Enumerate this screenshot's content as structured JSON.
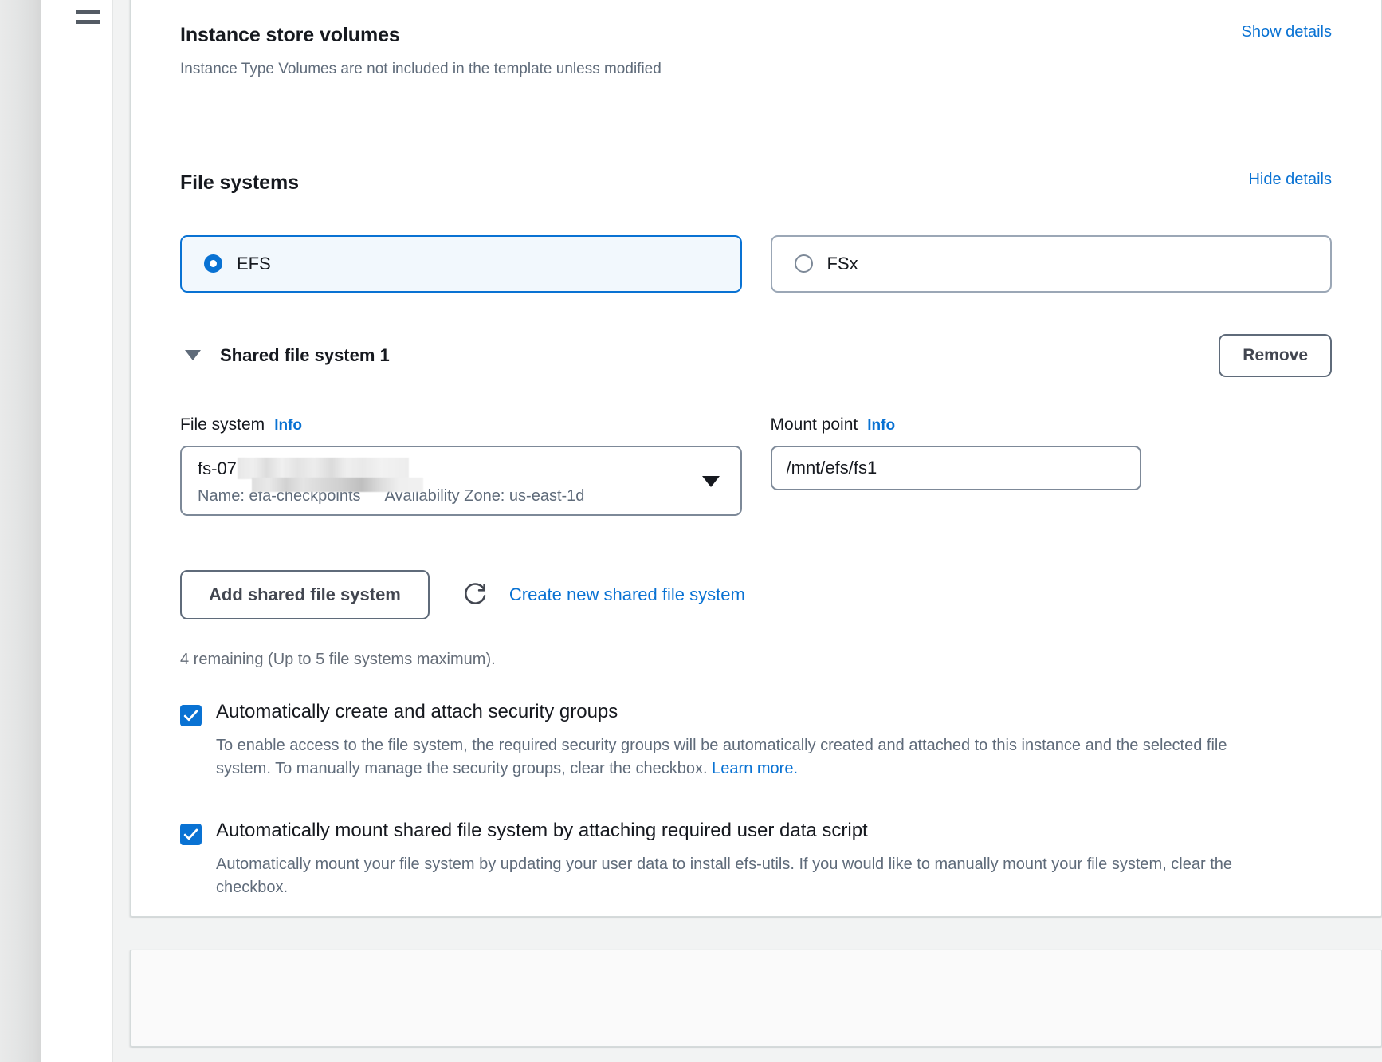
{
  "nav": {
    "menu_icon": "hamburger-menu-icon"
  },
  "instance_store": {
    "title": "Instance store volumes",
    "description": "Instance Type Volumes are not included in the template unless modified",
    "details_toggle": "Show details"
  },
  "file_systems": {
    "title": "File systems",
    "details_toggle": "Hide details",
    "type_options": [
      {
        "label": "EFS",
        "selected": true
      },
      {
        "label": "FSx",
        "selected": false
      }
    ],
    "shared": {
      "title": "Shared file system 1",
      "remove_label": "Remove",
      "file_system_field": {
        "label": "File system",
        "info_label": "Info",
        "value_prefix": "fs-07",
        "value_redacted": true,
        "meta_name": "Name: efa-checkpoints",
        "meta_az": "Availability Zone: us-east-1d"
      },
      "mount_point_field": {
        "label": "Mount point",
        "info_label": "Info",
        "value": "/mnt/efs/fs1",
        "placeholder": "/mnt/efs/fs1"
      }
    },
    "actions": {
      "add_label": "Add shared file system",
      "create_label": "Create new shared file system",
      "refresh_icon": "refresh-icon"
    },
    "remaining_text": "4 remaining (Up to 5 file systems maximum).",
    "checkboxes": [
      {
        "label": "Automatically create and attach security groups",
        "checked": true,
        "description": "To enable access to the file system, the required security groups will be automatically created and attached to this instance and the selected file system. To manually manage the security groups, clear the checkbox.",
        "link_label": "Learn more."
      },
      {
        "label": "Automatically mount shared file system by attaching required user data script",
        "checked": true,
        "description": "Automatically mount your file system by updating your user data to install efs-utils. If you would like to manually mount your file system, clear the checkbox.",
        "link_label": ""
      }
    ]
  },
  "colors": {
    "accent_blue": "#0972d3",
    "selected_tile_bg": "#f2f8fd",
    "text_primary": "#16191f",
    "text_secondary": "#5f6b7a",
    "border_grey": "#7d8998",
    "page_bg": "#f2f3f3"
  }
}
